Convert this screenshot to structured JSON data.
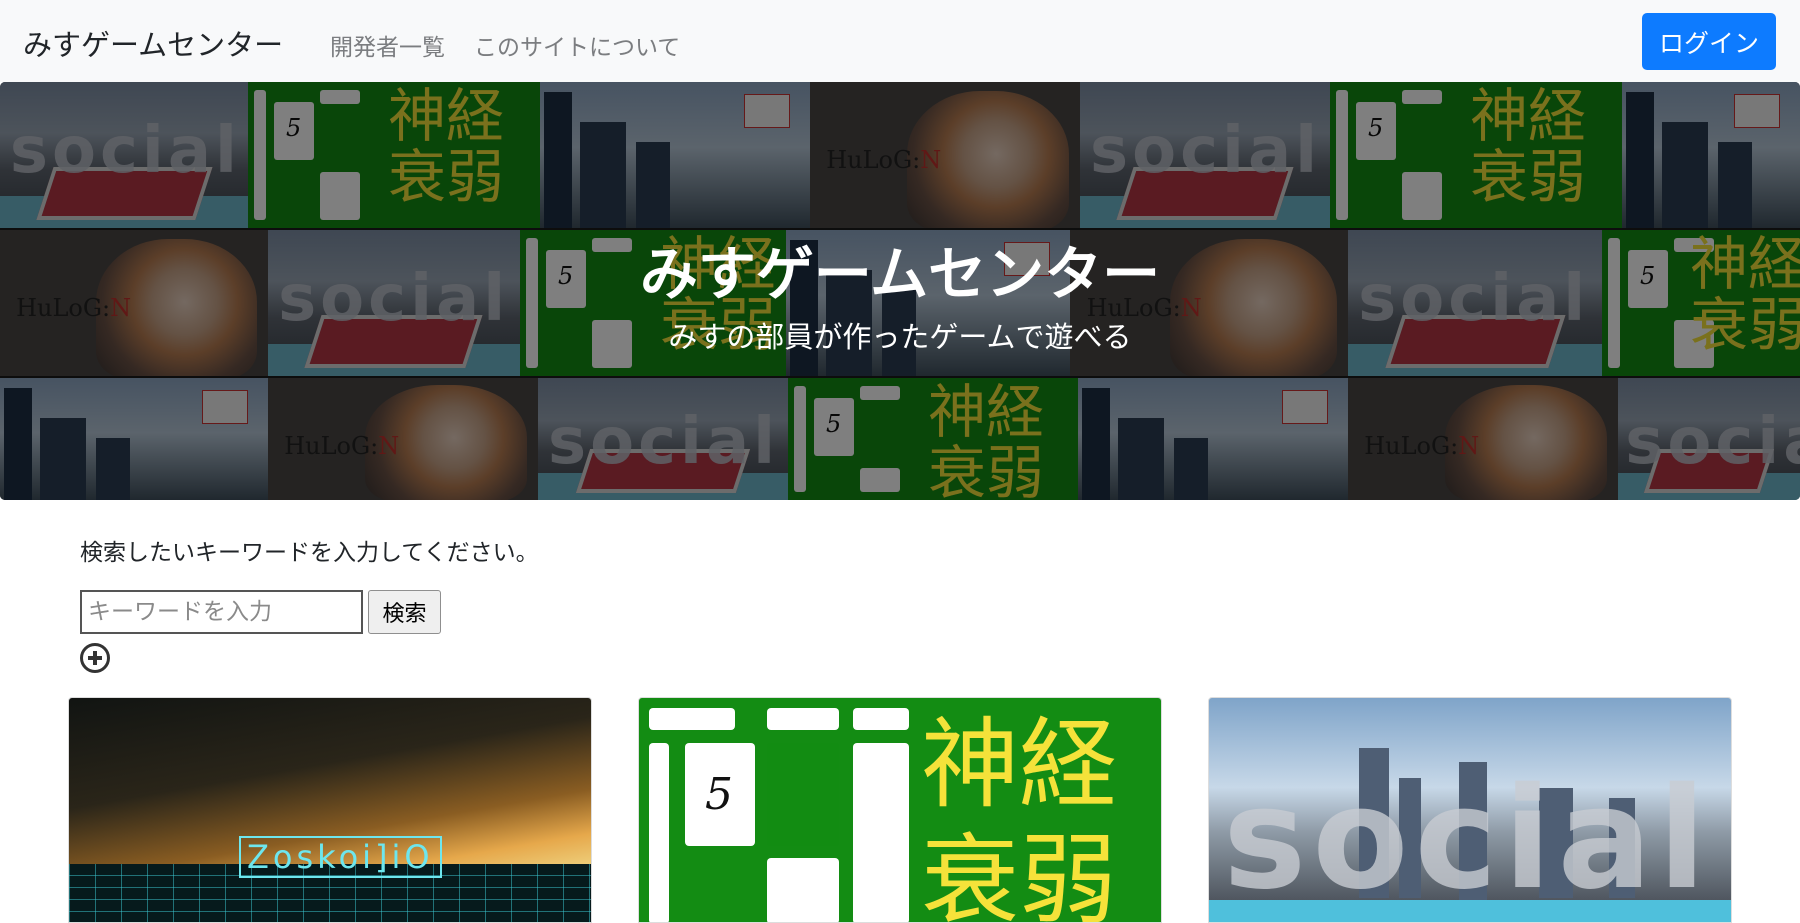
{
  "navbar": {
    "brand": "みすゲームセンター",
    "links": [
      "開発者一覧",
      "このサイトについて"
    ],
    "login_label": "ログイン"
  },
  "hero": {
    "title": "みすゲームセンター",
    "subtitle": "みすの部員が作ったゲームで遊べる",
    "tile_texts": {
      "social": "social",
      "shinkei_line1": "神経",
      "shinkei_line2": "衰弱",
      "card_number": "5",
      "hulog_prefix": "HuLoG:",
      "hulog_accent": "N"
    }
  },
  "search": {
    "label": "検索したいキーワードを入力してください。",
    "placeholder": "キーワードを入力",
    "button_label": "検索"
  },
  "games": [
    {
      "logo_text": "Zoskoi]iO"
    },
    {
      "title_line1": "神経",
      "title_line2": "衰弱",
      "card_number": "5"
    },
    {
      "logo_text": "social"
    }
  ],
  "colors": {
    "navbar_bg": "#f8f9fa",
    "login_btn": "#0d7bff",
    "shinkei_green": "#138c13",
    "shinkei_yellow": "#f5e23a"
  }
}
